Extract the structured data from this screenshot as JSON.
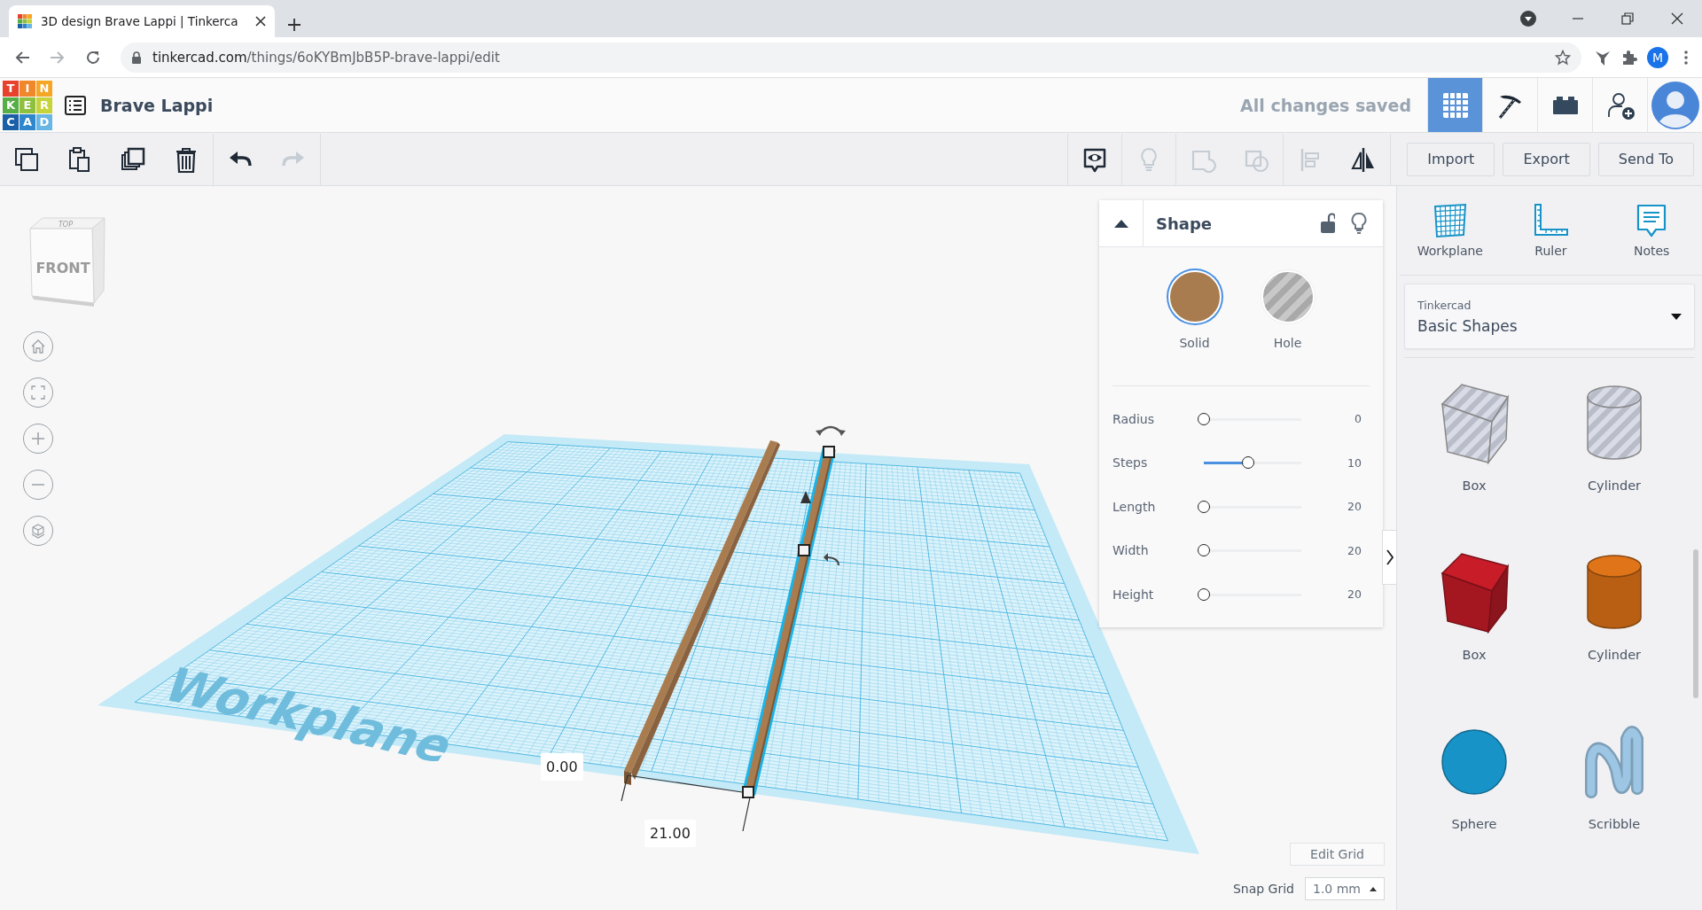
{
  "browser": {
    "tab": {
      "title": "3D design Brave Lappi | Tinkerca"
    },
    "address": {
      "host": "tinkercad.com",
      "path": "/things/6oKYBmJbB5P-brave-lappi/edit"
    },
    "profile_initial": "M"
  },
  "header": {
    "logo_letters": [
      {
        "letter": "T",
        "color": "#e8412c"
      },
      {
        "letter": "I",
        "color": "#f0872a"
      },
      {
        "letter": "N",
        "color": "#f5a623"
      },
      {
        "letter": "K",
        "color": "#58ae46"
      },
      {
        "letter": "E",
        "color": "#8dc03f"
      },
      {
        "letter": "R",
        "color": "#c6d33a"
      },
      {
        "letter": "C",
        "color": "#1a5fa8"
      },
      {
        "letter": "A",
        "color": "#2f86cc"
      },
      {
        "letter": "D",
        "color": "#69b6e4"
      }
    ],
    "title": "Brave Lappi",
    "save_status": "All changes saved",
    "views": [
      {
        "kind": "grid",
        "selected": true
      },
      {
        "kind": "pickaxe",
        "selected": false
      },
      {
        "kind": "bricks",
        "selected": false
      }
    ]
  },
  "toolbar": {
    "edit_tools": [
      {
        "kind": "copy",
        "disabled": false
      },
      {
        "kind": "paste",
        "disabled": false
      },
      {
        "kind": "duplicate",
        "disabled": false
      },
      {
        "kind": "delete",
        "disabled": false
      },
      {
        "kind": "undo",
        "disabled": false
      },
      {
        "kind": "redo",
        "disabled": true
      }
    ],
    "shape_tools": [
      {
        "kind": "notes",
        "disabled": false
      },
      {
        "kind": "bulb",
        "disabled": true
      },
      {
        "kind": "group",
        "disabled": true
      },
      {
        "kind": "ungroup",
        "disabled": true
      },
      {
        "kind": "align",
        "disabled": true
      },
      {
        "kind": "mirror",
        "disabled": false
      }
    ],
    "buttons": [
      "Import",
      "Export",
      "Send To"
    ]
  },
  "viewcube": {
    "top": "TOP",
    "front": "FRONT"
  },
  "canvas": {
    "plane_label": "Workplane",
    "measures": [
      "0.00",
      "21.00"
    ]
  },
  "shape_panel": {
    "title": "Shape",
    "modes": [
      {
        "kind": "solid",
        "label": "Solid",
        "selected": true
      },
      {
        "kind": "hole",
        "label": "Hole",
        "selected": false
      }
    ],
    "params": [
      {
        "name": "Radius",
        "level": 0,
        "reading": "0"
      },
      {
        "name": "Steps",
        "level": 0.45,
        "reading": "10"
      },
      {
        "name": "Length",
        "level": 0,
        "reading": "20"
      },
      {
        "name": "Width",
        "level": 0,
        "reading": "20"
      },
      {
        "name": "Height",
        "level": 0,
        "reading": "20"
      }
    ]
  },
  "grid_controls": {
    "edit_button": "Edit Grid",
    "snap_label": "Snap Grid",
    "snap_value": "1.0 mm"
  },
  "sidebar": {
    "tools": [
      {
        "kind": "workplane",
        "label": "Workplane"
      },
      {
        "kind": "ruler",
        "label": "Ruler"
      },
      {
        "kind": "notes",
        "label": "Notes"
      }
    ],
    "library": {
      "source": "Tinkercad",
      "category": "Basic Shapes"
    },
    "shapes": [
      {
        "kind": "box",
        "hole": true,
        "color": "#b9bdc9",
        "label": "Box"
      },
      {
        "kind": "cylinder",
        "hole": true,
        "color": "#b9bdc9",
        "label": "Cylinder"
      },
      {
        "kind": "box",
        "hole": false,
        "color": "#c81c28",
        "label": "Box"
      },
      {
        "kind": "cylinder",
        "hole": false,
        "color": "#e07418",
        "label": "Cylinder"
      },
      {
        "kind": "sphere",
        "color": "#1793c8",
        "label": "Sphere"
      },
      {
        "kind": "scribble",
        "color": "#9cc6e4",
        "label": "Scribble"
      }
    ]
  }
}
